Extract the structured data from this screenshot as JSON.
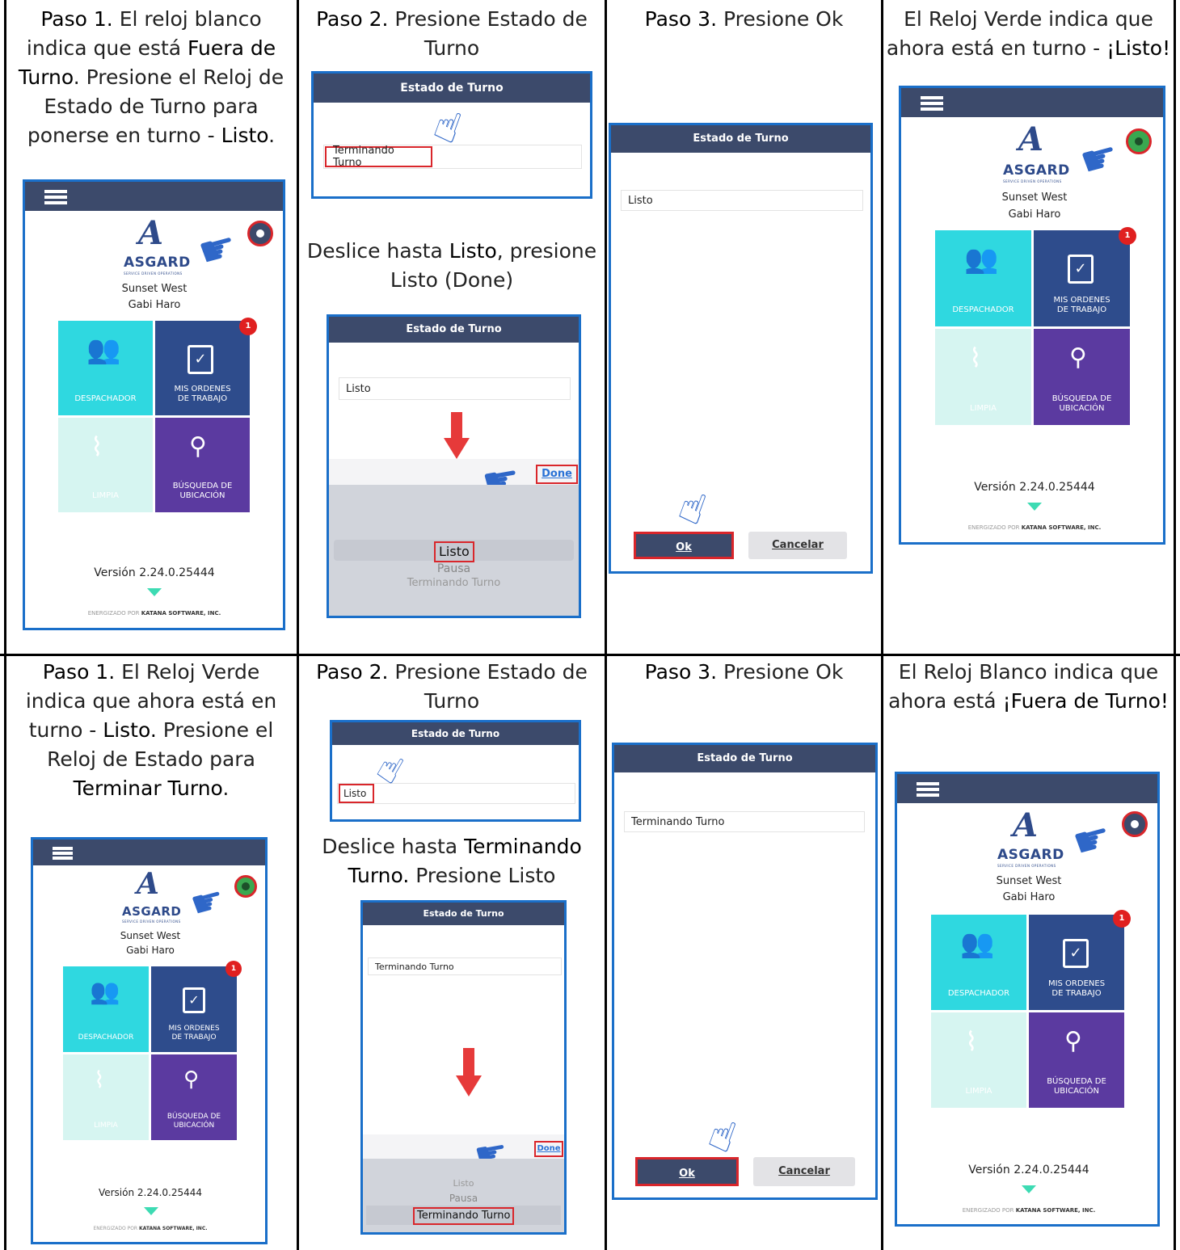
{
  "row1": {
    "c1": {
      "t1": "Paso 1.",
      "t2": "El reloj blanco indica que está",
      "t3": "Fuera de Turno",
      "t4": ". Presione el Reloj de Estado de Turno para ponerse en turno -",
      "t5": "Listo",
      "t6": "."
    },
    "c2": {
      "t1": "Paso 2.",
      "t2": "Presione Estado de Turno",
      "t3": "Deslice hasta",
      "t4": "Listo",
      "t5": ", presione Listo (Done)"
    },
    "c3": {
      "t1": "Paso 3.",
      "t2": "Presione Ok"
    },
    "c4": {
      "t1": "El Reloj Verde indica que ahora está en turno -",
      "t2": "¡Listo!"
    }
  },
  "row2": {
    "c1": {
      "t1": "Paso 1.",
      "t2": "El Reloj Verde indica que ahora está en turno -",
      "t3": "Listo.",
      "t4": "Presione el Reloj de Estado para",
      "t5": "Terminar Turno",
      "t6": "."
    },
    "c2": {
      "t1": "Paso 2.",
      "t2": "Presione Estado de Turno",
      "t3": "Deslice hasta",
      "t4": "Terminando Turno.",
      "t5": "Presione Listo"
    },
    "c3": {
      "t1": "Paso 3.",
      "t2": "Presione Ok"
    },
    "c4": {
      "t1": "El Reloj Blanco indica que ahora está",
      "t2": "¡Fuera de Turno!"
    }
  },
  "app": {
    "brand": "ASGARD",
    "brand_sub": "SERVICE DRIVEN OPERATIONS",
    "location": "Sunset West",
    "user": "Gabi Haro",
    "tile_dispatch": "DESPACHADOR",
    "tile_orders": "MIS ORDENES DE TRABAJO",
    "tile_clean": "LIMPIA",
    "tile_search": "BÚSQUEDA DE UBICACIÓN",
    "badge": "1",
    "version": "Versión 2.24.0.25444",
    "powered": "ENERGIZADO POR",
    "company": "KATANA SOFTWARE, INC."
  },
  "modal": {
    "title": "Estado de Turno",
    "ending": "Terminando Turno",
    "ready": "Listo",
    "pause": "Pausa",
    "done": "Done",
    "ok": "Ok",
    "cancel": "Cancelar"
  },
  "colors": {
    "frame": "#1a6fc9",
    "appbar": "#3c4a6b",
    "dispatch": "#2fd8e0",
    "orders": "#2e4c8c",
    "clean": "#d6f5f1",
    "search": "#5b3aa0",
    "green_clock": "#3aa850",
    "red": "#d9262b"
  }
}
